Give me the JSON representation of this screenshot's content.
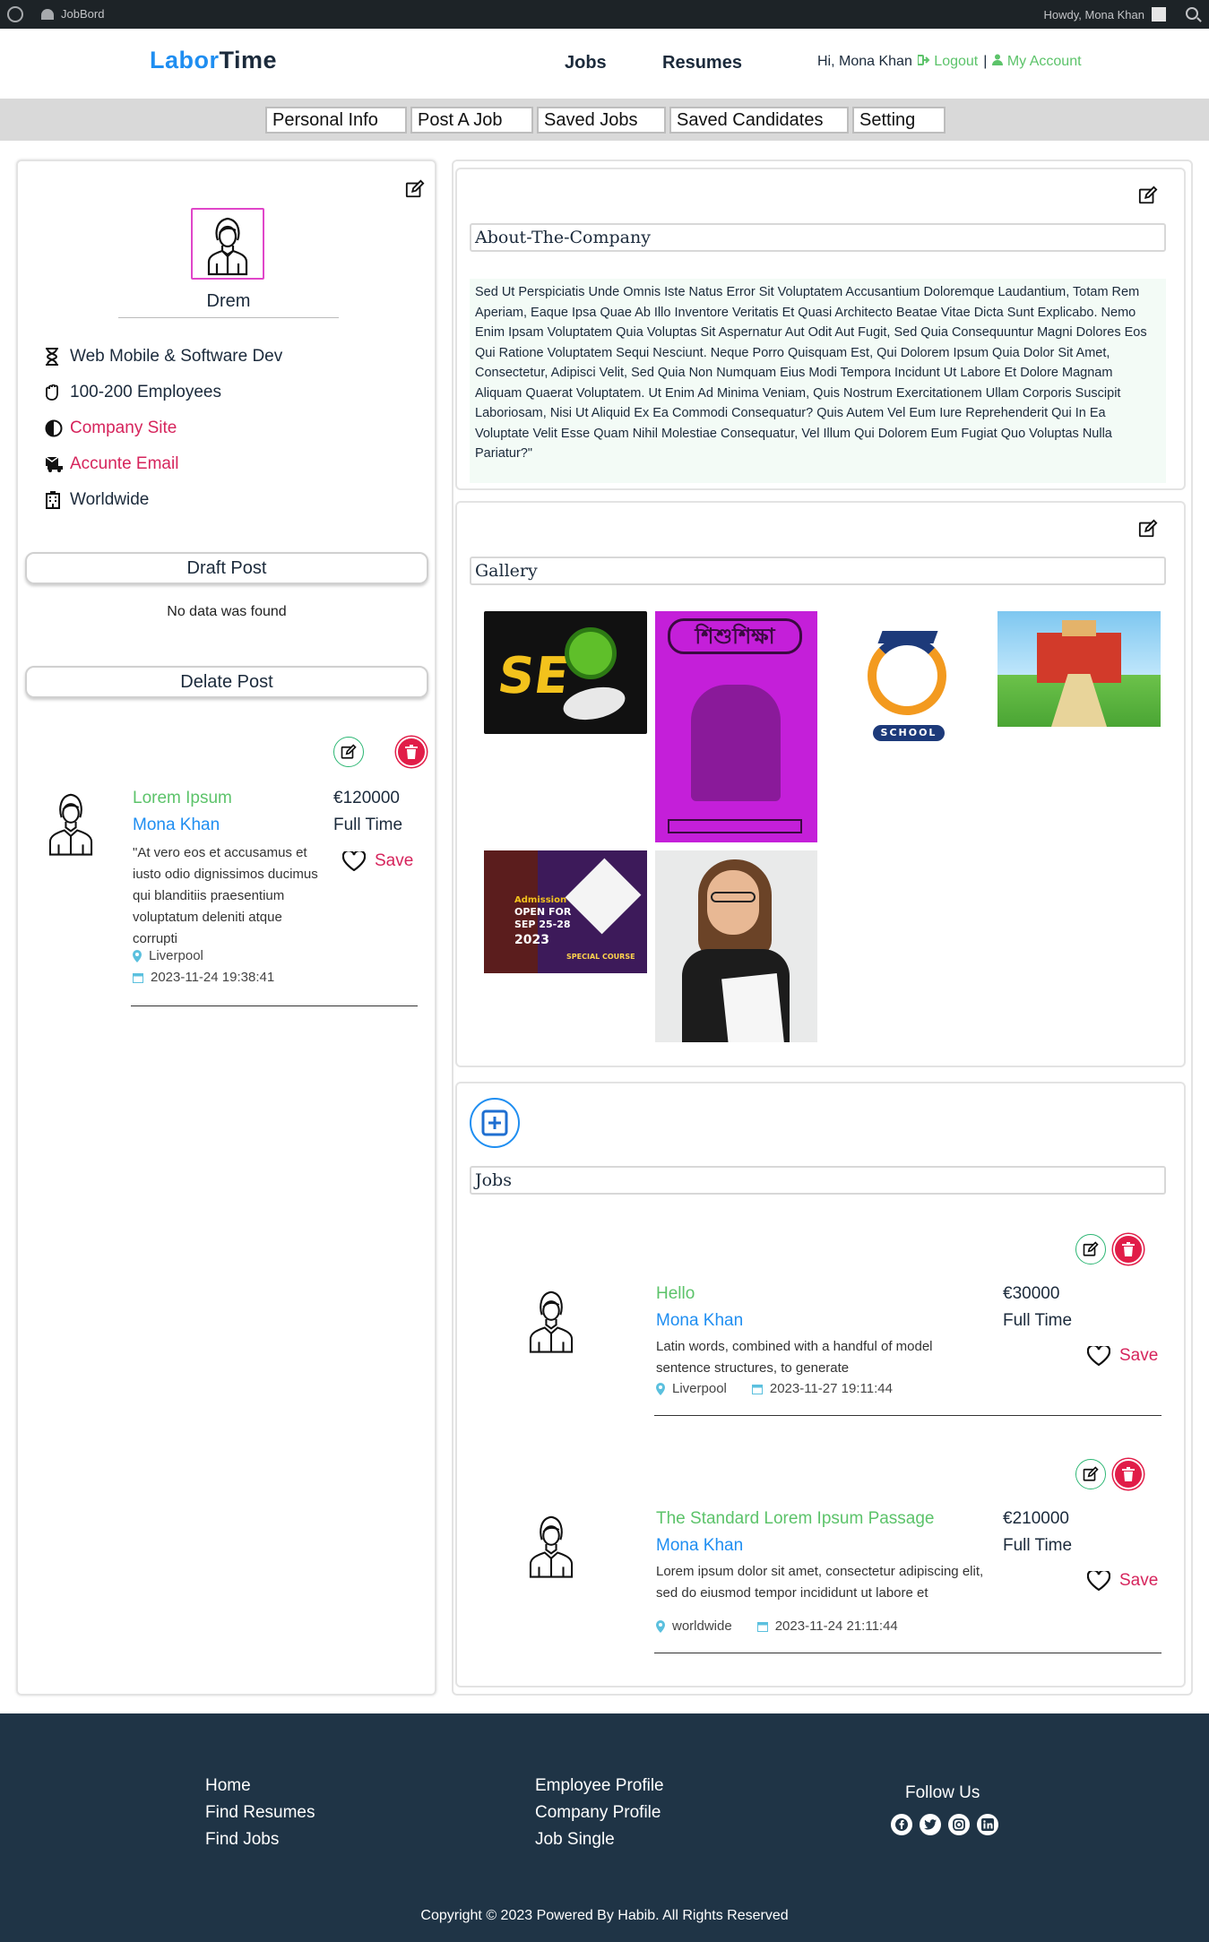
{
  "adminbar": {
    "site_name": "JobBord",
    "howdy": "Howdy, Mona Khan"
  },
  "header": {
    "logo_part1": "Labor",
    "logo_part2": "Time",
    "nav": [
      "Jobs",
      "Resumes"
    ],
    "greeting": "Hi, Mona Khan",
    "logout": "Logout",
    "separator": "|",
    "my_account": "My Account"
  },
  "tabs": [
    "Personal Info",
    "Post A Job",
    "Saved Jobs",
    "Saved Candidates",
    "Setting"
  ],
  "company": {
    "name": "Drem",
    "info": [
      {
        "icon": "hourglass-icon",
        "text": "Web Mobile & Software Dev"
      },
      {
        "icon": "hand-icon",
        "text": "100-200 Employees"
      },
      {
        "icon": "half-circle-icon",
        "text": "Company Site"
      },
      {
        "icon": "envelope-truck-icon",
        "text": "Accunte Email"
      },
      {
        "icon": "building-icon",
        "text": "Worldwide"
      }
    ]
  },
  "draft": {
    "title": "Draft Post",
    "empty": "No data was found"
  },
  "deleted": {
    "title": "Delate Post",
    "job": {
      "title": "Lorem Ipsum",
      "author": "Mona Khan",
      "desc": "\"At vero eos et accusamus et iusto odio dignissimos ducimus qui blanditiis praesentium voluptatum deleniti atque corrupti",
      "location": "Liverpool",
      "date": "2023-11-24 19:38:41",
      "salary": "€120000",
      "type": "Full Time",
      "save": "Save"
    }
  },
  "about": {
    "title": "About-The-Company",
    "text": "Sed Ut Perspiciatis Unde Omnis Iste Natus Error Sit Voluptatem Accusantium Doloremque Laudantium, Totam Rem Aperiam, Eaque Ipsa Quae Ab Illo Inventore Veritatis Et Quasi Architecto Beatae Vitae Dicta Sunt Explicabo. Nemo Enim Ipsam Voluptatem Quia Voluptas Sit Aspernatur Aut Odit Aut Fugit, Sed Quia Consequuntur Magni Dolores Eos Qui Ratione Voluptatem Sequi Nesciunt. Neque Porro Quisquam Est, Qui Dolorem Ipsum Quia Dolor Sit Amet, Consectetur, Adipisci Velit, Sed Quia Non Numquam Eius Modi Tempora Incidunt Ut Labore Et Dolore Magnam Aliquam Quaerat Voluptatem. Ut Enim Ad Minima Veniam, Quis Nostrum Exercitationem Ullam Corporis Suscipit Laboriosam, Nisi Ut Aliquid Ex Ea Commodi Consequatur? Quis Autem Vel Eum Iure Reprehenderit Qui In Ea Voluptate Velit Esse Quam Nihil Molestiae Consequatur, Vel Illum Qui Dolorem Eum Fugiat Quo Voluptas Nulla Pariatur?\""
  },
  "gallery": {
    "title": "Gallery",
    "images": {
      "seo_text": "SE",
      "book_title": "শিশুশিক্ষা",
      "school_badge": "SCHOOL",
      "admission_head": "Admission",
      "admission_open": "OPEN FOR",
      "admission_dates": "SEP 25-28",
      "admission_year": "2023",
      "admission_course": "SPECIAL COURSE"
    }
  },
  "jobs": {
    "title": "Jobs",
    "items": [
      {
        "title": "Hello",
        "author": "Mona Khan",
        "desc": "Latin words, combined with a handful of model sentence structures, to generate",
        "location": "Liverpool",
        "date": "2023-11-27 19:11:44",
        "salary": "€30000",
        "type": "Full Time",
        "save": "Save"
      },
      {
        "title": "The Standard Lorem Ipsum Passage",
        "author": "Mona Khan",
        "desc": "Lorem ipsum dolor sit amet, consectetur adipiscing elit, sed do eiusmod tempor incididunt ut labore et",
        "location": "worldwide",
        "date": "2023-11-24 21:11:44",
        "salary": "€210000",
        "type": "Full Time",
        "save": "Save"
      }
    ]
  },
  "footer": {
    "col1": [
      "Home",
      "Find Resumes",
      "Find Jobs"
    ],
    "col2": [
      "Employee Profile",
      "Company Profile",
      "Job Single"
    ],
    "follow": "Follow Us",
    "social_icons": [
      "facebook-icon",
      "twitter-icon",
      "instagram-icon",
      "linkedin-icon"
    ],
    "copyright": "Copyright © 2023 Powered By Habib. All Rights Reserved"
  },
  "colors": {
    "brand_blue": "#1f8ef1",
    "green": "#5cc36a",
    "pink": "#d6245c",
    "footer_bg": "#1f3446",
    "delete_red": "#e11d48"
  }
}
